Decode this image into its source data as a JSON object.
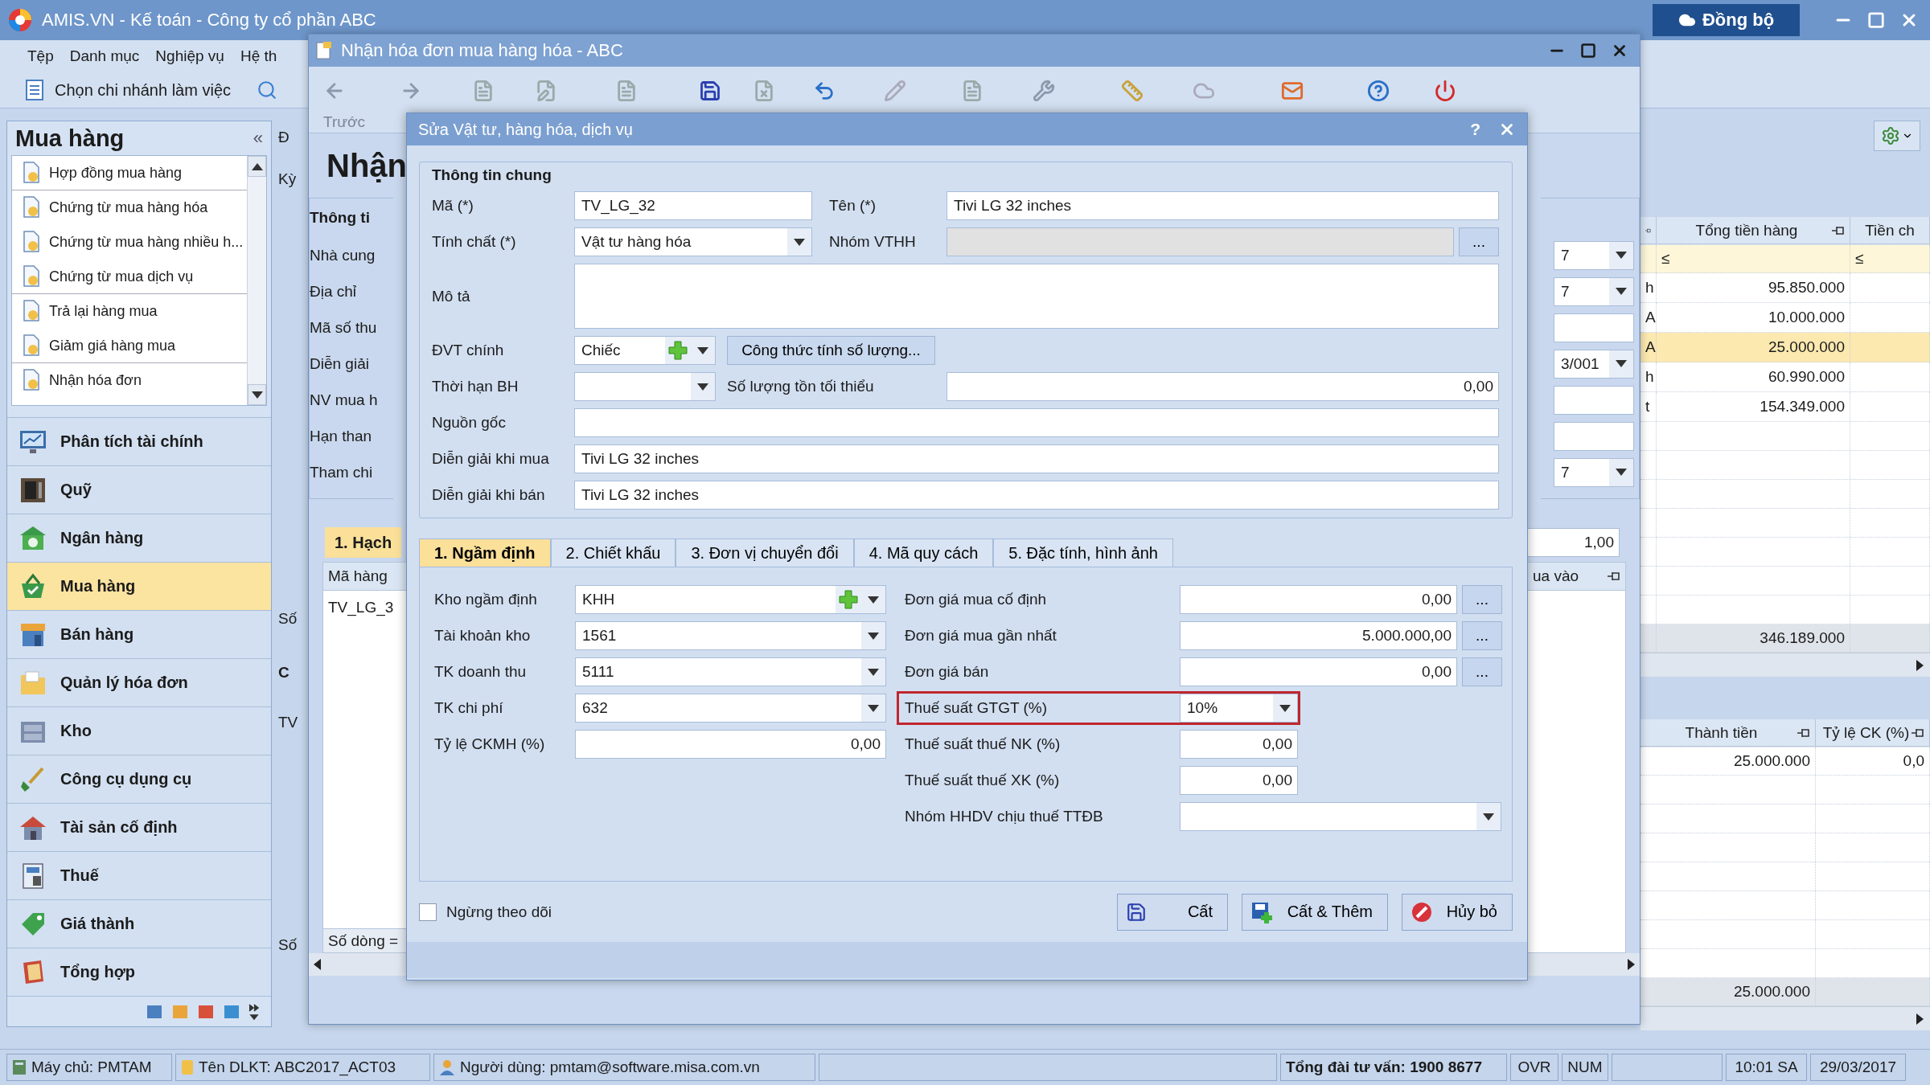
{
  "app": {
    "title": "AMIS.VN - Kế toán - Công ty cổ phần ABC",
    "sync_button": "Đồng bộ"
  },
  "menu": [
    "Tệp",
    "Danh mục",
    "Nghiệp vụ",
    "Hệ th"
  ],
  "toolbar": {
    "branch": "Chọn chi nhánh làm việc"
  },
  "sidebar": {
    "title": "Mua hàng",
    "collapse": "«",
    "items": [
      {
        "label": "Hợp đồng mua hàng",
        "separator_after": true
      },
      {
        "label": "Chứng từ mua hàng hóa",
        "separator_after": false
      },
      {
        "label": "Chứng từ mua hàng nhiều h...",
        "separator_after": false
      },
      {
        "label": "Chứng từ mua dịch vụ",
        "separator_after": true
      },
      {
        "label": "Trả lại hàng mua",
        "separator_after": false
      },
      {
        "label": "Giảm giá hàng mua",
        "separator_after": true
      },
      {
        "label": "Nhận hóa đơn",
        "separator_after": false
      }
    ],
    "modules": [
      {
        "label": "Phân tích tài chính",
        "selected": false
      },
      {
        "label": "Quỹ",
        "selected": false
      },
      {
        "label": "Ngân hàng",
        "selected": false
      },
      {
        "label": "Mua hàng",
        "selected": true
      },
      {
        "label": "Bán hàng",
        "selected": false
      },
      {
        "label": "Quản lý hóa đơn",
        "selected": false
      },
      {
        "label": "Kho",
        "selected": false
      },
      {
        "label": "Công cụ dụng cụ",
        "selected": false
      },
      {
        "label": "Tài sản cố định",
        "selected": false
      },
      {
        "label": "Thuế",
        "selected": false
      },
      {
        "label": "Giá thành",
        "selected": false
      },
      {
        "label": "Tổng hợp",
        "selected": false
      }
    ]
  },
  "content_fragments": [
    "Đ",
    "Kỳ",
    "Số",
    "C",
    "TV",
    "Số"
  ],
  "right_grid": {
    "columns": [
      "Tổng tiền hàng",
      "Tiền ch"
    ],
    "filter": [
      "≤",
      "≤"
    ],
    "rows": [
      {
        "cut": "h",
        "total": "95.850.000",
        "selected": false
      },
      {
        "cut": "A",
        "total": "10.000.000",
        "selected": false
      },
      {
        "cut": "A",
        "total": "25.000.000",
        "selected": true
      },
      {
        "cut": "h",
        "total": "60.990.000",
        "selected": false
      },
      {
        "cut": "t",
        "total": "154.349.000",
        "selected": false
      }
    ],
    "sum": "346.189.000"
  },
  "detail_grid": {
    "columns": [
      "Thành tiền",
      "Tỷ lệ CK (%)"
    ],
    "rows": [
      {
        "amount": "25.000.000",
        "rate": "0,0"
      }
    ],
    "sum": "25.000.000"
  },
  "invoice_window": {
    "title": "Nhận hóa đơn mua hàng hóa - ABC",
    "back_label": "Trước",
    "heading": "Nhận",
    "group": "Thông ti",
    "labels": [
      "Nhà cung",
      "Địa chỉ",
      "Mã số thu",
      "Diễn giải",
      "NV mua h",
      "Hạn than",
      "Tham chi"
    ],
    "right_fields": [
      {
        "kind": "combo",
        "value": "7"
      },
      {
        "kind": "combo",
        "value": "7"
      },
      {
        "kind": "text"
      },
      {
        "kind": "combo",
        "value": "3/001"
      },
      {
        "kind": "text"
      },
      {
        "kind": "text"
      },
      {
        "kind": "combo",
        "value": "7"
      }
    ],
    "rate": "1,00",
    "tab": "1. Hạch",
    "grid_column": "Mã hàng",
    "grid_column_right": "ua vào",
    "grid_row": "TV_LG_3",
    "footer": "Số dòng ="
  },
  "dialog": {
    "title": "Sửa Vật tư, hàng hóa, dịch vụ",
    "help": "?",
    "group": "Thông tin chung",
    "rows": [
      {
        "left": {
          "label": "Mã (*)",
          "kind": "text",
          "value": "TV_LG_32"
        },
        "right": {
          "label": "Tên (*)",
          "kind": "text",
          "value": "Tivi LG 32 inches"
        }
      },
      {
        "left": {
          "label": "Tính chất (*)",
          "kind": "combo",
          "value": "Vật tư hàng hóa"
        },
        "right": {
          "label": "Nhóm VTHH",
          "kind": "lookup",
          "disabled": true,
          "button": "..."
        }
      },
      {
        "full": {
          "label": "Mô tả",
          "kind": "memo"
        }
      },
      {
        "left": {
          "label": "ĐVT chính",
          "kind": "combo-add",
          "value": "Chiếc"
        },
        "right": {
          "kind": "button",
          "text": "Công thức tính số lượng..."
        }
      },
      {
        "left": {
          "label": "Thời hạn BH",
          "kind": "combo"
        },
        "right": {
          "label": "Số lượng tồn tối thiểu",
          "kind": "number",
          "value": "0,00"
        }
      },
      {
        "full": {
          "label": "Nguồn gốc",
          "kind": "text"
        }
      },
      {
        "full": {
          "label": "Diễn giải khi mua",
          "kind": "text",
          "value": "Tivi LG 32 inches"
        }
      },
      {
        "full": {
          "label": "Diễn giải khi bán",
          "kind": "text",
          "value": "Tivi LG 32 inches"
        }
      }
    ],
    "tabs": [
      {
        "label": "1. Ngầm định",
        "selected": true
      },
      {
        "label": "2. Chiết khấu",
        "selected": false
      },
      {
        "label": "3. Đơn vị chuyển đổi",
        "selected": false
      },
      {
        "label": "4. Mã quy cách",
        "selected": false
      },
      {
        "label": "5. Đặc tính, hình ảnh",
        "selected": false
      }
    ],
    "left_fields": [
      {
        "label": "Kho ngầm định",
        "kind": "combo-add",
        "value": "KHH"
      },
      {
        "label": "Tài khoản kho",
        "kind": "combo",
        "value": "1561"
      },
      {
        "label": "TK doanh thu",
        "kind": "combo",
        "value": "5111"
      },
      {
        "label": "TK chi phí",
        "kind": "combo",
        "value": "632"
      },
      {
        "label": "Tỷ lệ CKMH (%)",
        "kind": "number",
        "value": "0,00"
      }
    ],
    "right_fields": [
      {
        "label": "Đơn giá mua cố định",
        "kind": "lookup",
        "value": "0,00",
        "button": "...",
        "highlighted": false
      },
      {
        "label": "Đơn giá mua gần nhất",
        "kind": "lookup",
        "value": "5.000.000,00",
        "button": "...",
        "highlighted": false
      },
      {
        "label": "Đơn giá bán",
        "kind": "lookup",
        "value": "0,00",
        "button": "...",
        "highlighted": false
      },
      {
        "label": "Thuế suất GTGT (%)",
        "kind": "combo",
        "value": "10%",
        "highlighted": true
      },
      {
        "label": "Thuế suất thuế NK (%)",
        "kind": "number",
        "value": "0,00",
        "highlighted": false
      },
      {
        "label": "Thuế suất thuế XK (%)",
        "kind": "number",
        "value": "0,00",
        "highlighted": false
      },
      {
        "label": "Nhóm HHDV chịu thuế TTĐB",
        "kind": "wide-combo",
        "highlighted": false
      }
    ],
    "stop_tracking": {
      "label": "Ngừng theo dõi",
      "checked": false
    },
    "buttons": [
      {
        "label": "Cất",
        "kind": "save"
      },
      {
        "label": "Cất & Thêm",
        "kind": "save-add"
      },
      {
        "label": "Hủy bỏ",
        "kind": "cancel"
      }
    ]
  },
  "status_bar": [
    {
      "text": "Máy chủ: PMTAM",
      "kind": "server"
    },
    {
      "text": "Tên DLKT: ABC2017_ACT03",
      "kind": "database"
    },
    {
      "text": "Người dùng: pmtam@software.misa.com.vn",
      "kind": "user"
    },
    {
      "kind": "empty"
    },
    {
      "text": "Tổng đài tư vấn: 1900 8677",
      "kind": "hotline"
    },
    {
      "text": "OVR",
      "kind": "plain"
    },
    {
      "text": "NUM",
      "kind": "plain"
    },
    {
      "kind": "empty"
    },
    {
      "text": "10:01 SA",
      "kind": "plain"
    },
    {
      "text": "29/03/2017",
      "kind": "plain"
    }
  ]
}
